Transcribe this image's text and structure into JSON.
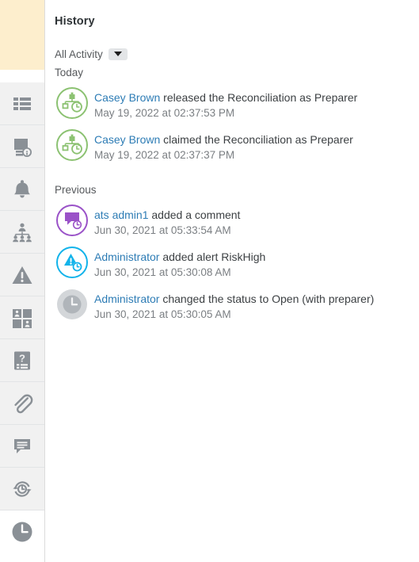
{
  "panel": {
    "title": "History",
    "filter": {
      "label": "All Activity",
      "caret_icon": "chevron-down-icon"
    },
    "groups": [
      {
        "header": "Today",
        "entries": [
          {
            "icon": "workflow-release-icon",
            "icon_color": "#8cc272",
            "actor": "Casey Brown",
            "action": "released the Reconciliation as Preparer",
            "timestamp": "May 19, 2022 at 02:37:53 PM"
          },
          {
            "icon": "workflow-claim-icon",
            "icon_color": "#8cc272",
            "actor": "Casey Brown",
            "action": "claimed the Reconciliation as Preparer",
            "timestamp": "May 19, 2022 at 02:37:37 PM"
          }
        ]
      },
      {
        "header": "Previous",
        "entries": [
          {
            "icon": "comment-added-icon",
            "icon_color": "#9a52c8",
            "actor": "ats admin1",
            "action": "added a comment",
            "timestamp": "Jun 30, 2021 at 05:33:54 AM"
          },
          {
            "icon": "alert-added-icon",
            "icon_color": "#12b3ea",
            "actor": "Administrator",
            "action": "added alert RiskHigh",
            "timestamp": "Jun 30, 2021 at 05:30:08 AM"
          },
          {
            "icon": "status-change-clock-icon",
            "icon_color": "#b8bcc0",
            "actor": "Administrator",
            "action": "changed the status to Open (with preparer)",
            "timestamp": "Jun 30, 2021 at 05:30:05 AM"
          }
        ]
      }
    ]
  },
  "sidebar": {
    "items": [
      {
        "name": "list-icon",
        "label": "List"
      },
      {
        "name": "document-info-icon",
        "label": "Details"
      },
      {
        "name": "bell-icon",
        "label": "Notifications"
      },
      {
        "name": "org-chart-icon",
        "label": "Workflow"
      },
      {
        "name": "warning-icon",
        "label": "Alerts"
      },
      {
        "name": "users-grid-icon",
        "label": "Assignments"
      },
      {
        "name": "question-doc-icon",
        "label": "Questions"
      },
      {
        "name": "paperclip-icon",
        "label": "Attachments"
      },
      {
        "name": "comment-icon",
        "label": "Comments"
      },
      {
        "name": "history-sync-icon",
        "label": "Recurrence"
      },
      {
        "name": "clock-icon",
        "label": "History",
        "active": true
      }
    ]
  },
  "colors": {
    "link": "#2d7cb5",
    "text": "#3c4043",
    "muted": "#7b7f83",
    "rail_bg": "#f1f1f1",
    "rail_icon": "#8a9096",
    "highlight_block": "#fdeecd"
  }
}
